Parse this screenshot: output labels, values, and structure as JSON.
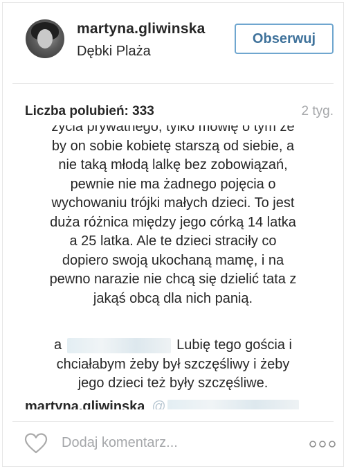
{
  "post_header": {
    "username": "martyna.gliwinska",
    "location": "Dębki Plaża",
    "follow_label": "Obserwuj"
  },
  "meta": {
    "likes_label": "Liczba polubień: 333",
    "time_ago": "2 tyg."
  },
  "comments": {
    "block1_lines": [
      "życia prywatnego, tylko mówię o tym że",
      "by on sobie kobietę starszą od siebie, a",
      "nie taką młodą lalkę bez zobowiązań,",
      "pewnie nie ma żadnego pojęcia o",
      "wychowaniu trójki małych dzieci. To jest",
      "duża różnica między jego córką 14 latka",
      "a 25 latka. Ale te dzieci straciły co",
      "dopiero swoją ukochaną mamę, i na",
      "pewno narazie nie chcą się dzielić tata z",
      "jakąś obcą dla nich panią."
    ],
    "block2_prefix": "a",
    "block2_line1_suffix": "Lubię tego gościa i",
    "block2_lines": [
      "chciałabym żeby był szczęśliwy i żeby",
      "jego dzieci też były szczęśliwe."
    ],
    "reply_author": "martyna.gliwinska",
    "reply_mention_prefix": "@"
  },
  "actions": {
    "comment_placeholder": "Dodaj komentarz...",
    "like_icon": "heart-outline-icon",
    "more_icon": "ellipsis-icon"
  },
  "colors": {
    "follow_border": "#6fa6cf",
    "follow_text": "#3f729b",
    "muted": "#a5a7aa"
  }
}
